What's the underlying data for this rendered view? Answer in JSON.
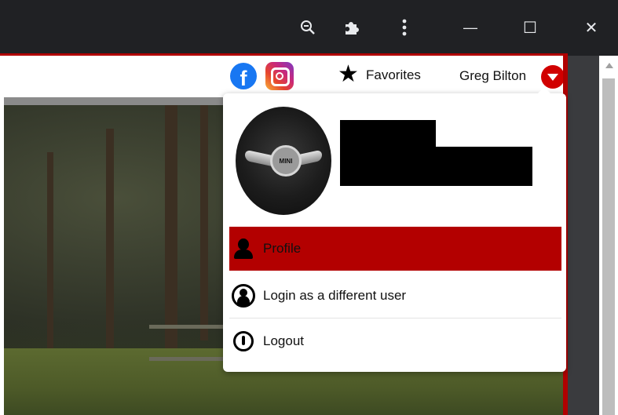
{
  "browser": {
    "zoom_icon": "zoom-out-icon",
    "extensions_icon": "puzzle-icon",
    "menu_icon": "kebab-menu-icon",
    "minimize_glyph": "—",
    "maximize_glyph": "☐",
    "close_glyph": "✕"
  },
  "site_nav": {
    "facebook_glyph": "f",
    "favorites_label": "Favorites",
    "user_name": "Greg Bilton"
  },
  "dropdown": {
    "items": [
      {
        "label": "Profile",
        "icon": "person-icon",
        "active": true
      },
      {
        "label": "Login as a different user",
        "icon": "switch-user-icon",
        "active": false
      },
      {
        "label": "Logout",
        "icon": "power-icon",
        "active": false
      }
    ],
    "avatar_badge": "MINI"
  },
  "colors": {
    "accent_red": "#b30000",
    "chrome_dark": "#202124",
    "facebook_blue": "#1877f2"
  }
}
